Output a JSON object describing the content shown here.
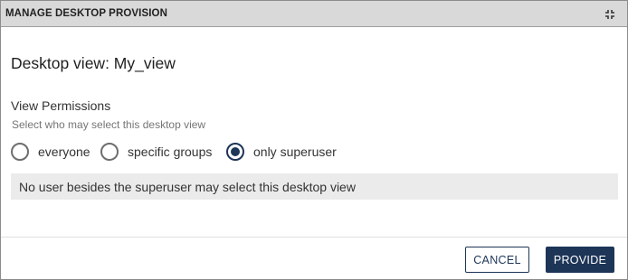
{
  "dialog": {
    "title": "MANAGE DESKTOP PROVISION",
    "collapse_icon": "collapse-arrows-icon"
  },
  "content": {
    "heading": "Desktop view: My_view",
    "permissions_label": "View Permissions",
    "permissions_hint": "Select who may select this desktop view",
    "options": [
      {
        "label": "everyone",
        "selected": false
      },
      {
        "label": "specific groups",
        "selected": false
      },
      {
        "label": "only superuser",
        "selected": true
      }
    ],
    "info_text": "No user besides the superuser may select this desktop view"
  },
  "footer": {
    "cancel_label": "CANCEL",
    "provide_label": "PROVIDE"
  },
  "colors": {
    "accent": "#1d3557",
    "titlebar": "#d9d9d9",
    "info_bg": "#ebebeb"
  }
}
